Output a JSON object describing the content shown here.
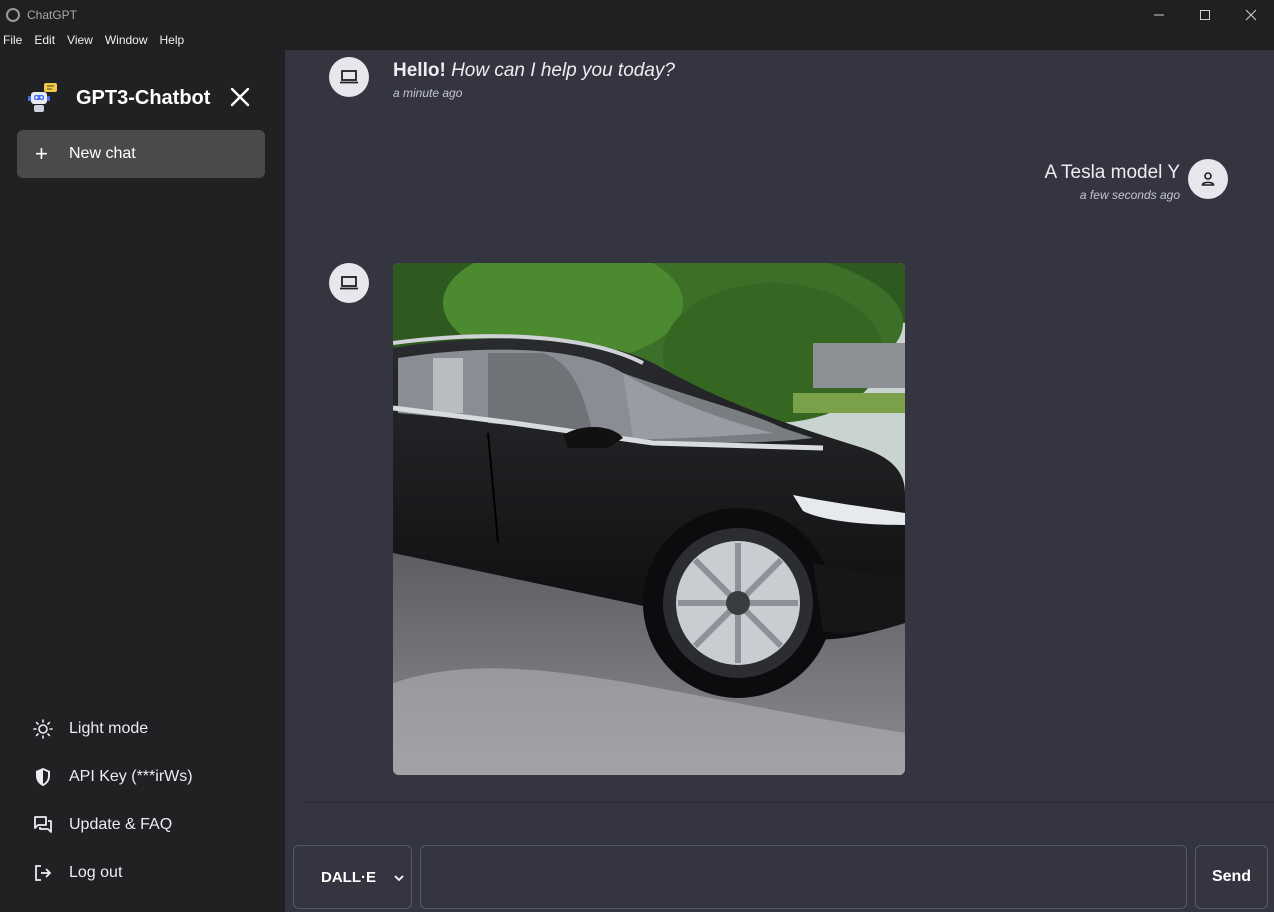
{
  "window": {
    "title": "ChatGPT"
  },
  "menubar": {
    "items": [
      "File",
      "Edit",
      "View",
      "Window",
      "Help"
    ]
  },
  "sidebar": {
    "brand": "GPT3-Chatbot",
    "new_chat_label": "New chat",
    "items": [
      {
        "label": "Light mode",
        "icon": "sun-icon"
      },
      {
        "label": "API Key (***irWs)",
        "icon": "shield-icon"
      },
      {
        "label": "Update & FAQ",
        "icon": "chat-bubbles-icon"
      },
      {
        "label": "Log out",
        "icon": "logout-icon"
      }
    ]
  },
  "messages": [
    {
      "role": "bot",
      "bold": "Hello!",
      "italic": "How can I help you today?",
      "time": "a minute ago"
    },
    {
      "role": "user",
      "text": "A Tesla model Y",
      "time": "a few seconds ago"
    },
    {
      "role": "bot",
      "type": "image",
      "description": "black Tesla car"
    }
  ],
  "composer": {
    "model_value": "DALL·E",
    "prompt_value": "",
    "send_label": "Send"
  },
  "colors": {
    "sidebar_bg": "#202123",
    "main_bg": "#343541",
    "avatar_bg": "#e6e7ec"
  }
}
